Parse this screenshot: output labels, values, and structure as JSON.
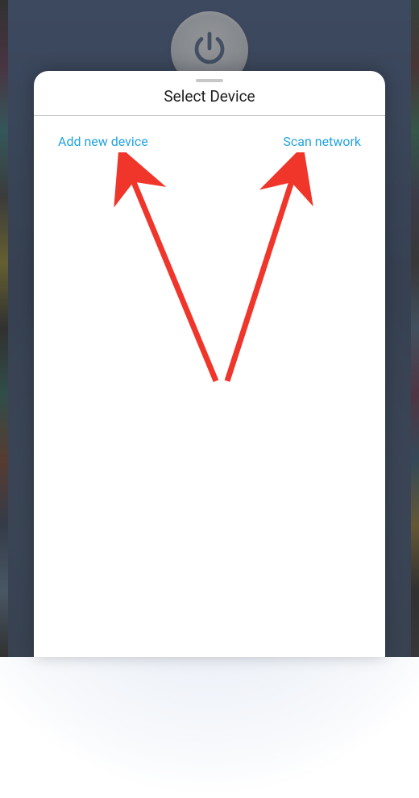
{
  "background": {
    "power_icon": "power-icon"
  },
  "sheet": {
    "title": "Select Device",
    "actions": {
      "add": "Add new device",
      "scan": "Scan network"
    }
  },
  "colors": {
    "accent_link": "#22a3e0",
    "annotation_arrow": "#f0352a"
  }
}
